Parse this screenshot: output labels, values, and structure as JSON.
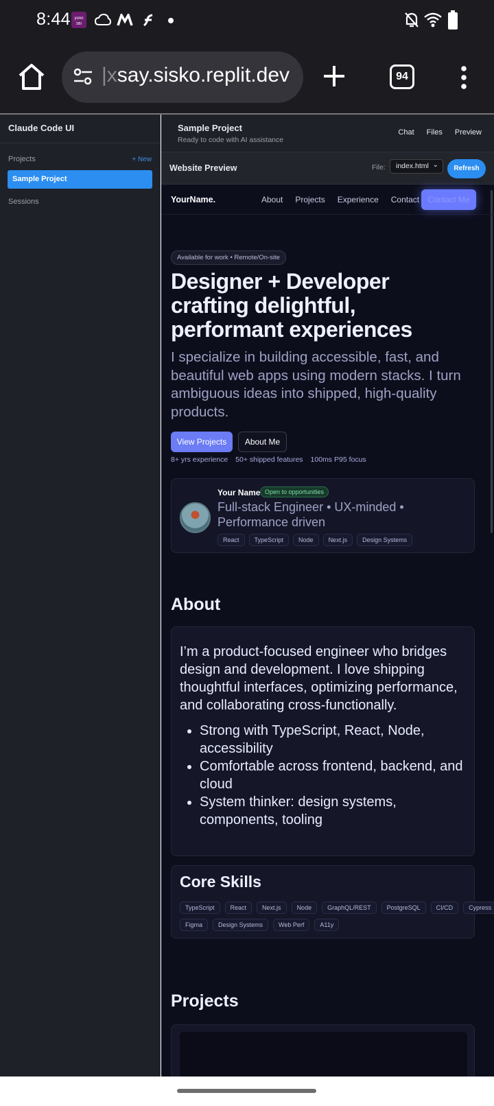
{
  "status": {
    "time": "8:44",
    "app_badge": "yono SBI"
  },
  "browser": {
    "url_faint": "|x",
    "url_main": "say.sisko.replit.dev",
    "tab_count": "94"
  },
  "sidebar": {
    "title": "Claude Code UI",
    "projects_label": "Projects",
    "new_label": "+ New",
    "active_project": "Sample Project",
    "sessions_label": "Sessions"
  },
  "header": {
    "project_title": "Sample Project",
    "subtitle": "Ready to code with AI assistance",
    "tabs": [
      "Chat",
      "Files",
      "Preview"
    ]
  },
  "preview_bar": {
    "title": "Website Preview",
    "file_label": "File:",
    "file_value": "index.html",
    "refresh_label": "Refresh"
  },
  "site": {
    "brand": "YourName.",
    "links": [
      "About",
      "Projects",
      "Experience",
      "Contact"
    ],
    "cta": "Contact Me",
    "badge": "Available for work • Remote/On-site",
    "headline": "Designer + Developer crafting delightful, performant experiences",
    "lead": "I specialize in building accessible, fast, and beautiful web apps using modern stacks. I turn ambiguous ideas into shipped, high-quality products.",
    "primary_btn": "View Projects",
    "secondary_btn": "About Me",
    "stats": [
      "8+ yrs experience",
      "50+ shipped features",
      "100ms P95 focus"
    ],
    "card": {
      "name": "Your Name",
      "status": "Open to opportunities",
      "role": "Full-stack Engineer • UX-minded • Performance driven",
      "tags": [
        "React",
        "TypeScript",
        "Node",
        "Next.js",
        "Design Systems"
      ]
    },
    "about_heading": "About",
    "about_text": "I’m a product-focused engineer who bridges design and development. I love shipping thoughtful interfaces, optimizing performance, and collaborating cross-functionally.",
    "about_points": [
      "Strong with TypeScript, React, Node, accessibility",
      "Comfortable across frontend, backend, and cloud",
      "System thinker: design systems, components, tooling"
    ],
    "skills_heading": "Core Skills",
    "skills_row1": [
      "TypeScript",
      "React",
      "Next.js",
      "Node",
      "GraphQL/REST",
      "PostgreSQL",
      "CI/CD",
      "Cypress"
    ],
    "skills_row2": [
      "Figma",
      "Design Systems",
      "Web Perf",
      "A11y"
    ],
    "projects_heading": "Projects"
  }
}
